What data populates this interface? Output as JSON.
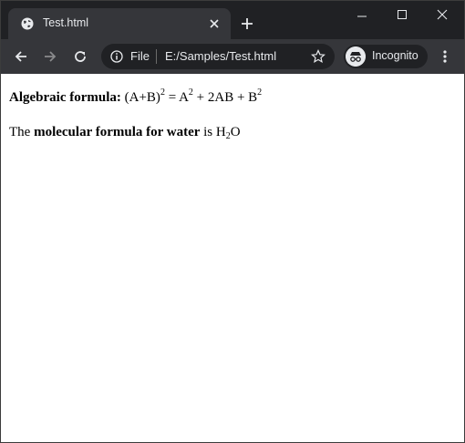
{
  "browser": {
    "tab_title": "Test.html",
    "url_scheme_label": "File",
    "url": "E:/Samples/Test.html",
    "incognito_label": "Incognito",
    "colors": {
      "titlebar": "#202124",
      "toolbar": "#35363a",
      "text": "#e8eaed"
    }
  },
  "page": {
    "line1": {
      "label": "Algebraic formula:",
      "p1": "(A+B)",
      "sup1": "2",
      "p2": " = A",
      "sup2": "2",
      "p3": " + 2AB + B",
      "sup3": "2"
    },
    "line2": {
      "prefix": "The ",
      "bold": "molecular formula for water",
      "middle": " is H",
      "sub": "2",
      "suffix": "O"
    }
  }
}
